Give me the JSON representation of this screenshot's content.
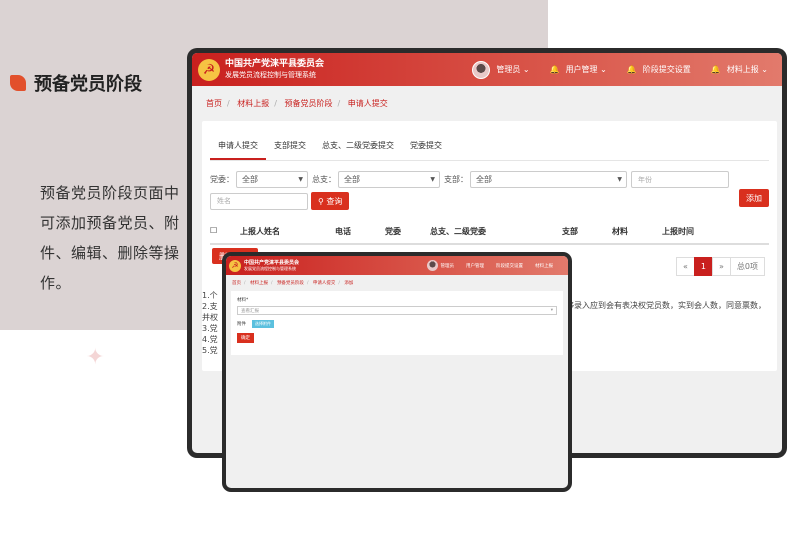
{
  "slide": {
    "title": "预备党员阶段",
    "description": "预备党员阶段页面中可添加预备党员、附件、编辑、删除等操作。"
  },
  "header": {
    "org_line1": "中国共产党涞平县委员会",
    "org_line2": "发展党员流程控制与管理系统",
    "user": "管理员",
    "menu_user_mgmt": "用户管理",
    "menu_stage_setting": "阶段提交设置",
    "menu_material_report": "材料上报"
  },
  "breadcrumb": [
    "首页",
    "材料上报",
    "预备党员阶段",
    "申请人提交"
  ],
  "tabs": [
    "申请人提交",
    "支部提交",
    "总支、二级党委提交",
    "党委提交"
  ],
  "filters": {
    "party_committee_label": "党委：",
    "party_committee_value": "全部",
    "general_branch_label": "总支：",
    "general_branch_value": "全部",
    "branch_label": "支部：",
    "branch_value": "全部",
    "year_placeholder": "年份",
    "name_placeholder": "姓名",
    "search_button": "查询",
    "add_button": "添加"
  },
  "table": {
    "columns": [
      "上报人姓名",
      "电话",
      "党委",
      "总支、二级党委",
      "支部",
      "材料",
      "上报时间"
    ]
  },
  "actions": {
    "delete_selected": "删除选中"
  },
  "pagination": {
    "prev": "«",
    "current": "1",
    "next": "»",
    "total": "总0项"
  },
  "notes": [
    "1.个",
    "2.支",
    "并权",
    "3.党",
    "4.党",
    "5.党"
  ],
  "note_right": "能够录入应到会有表决权党员数，实到会人数，同意票数，",
  "small_screen": {
    "breadcrumb": [
      "首页",
      "材料上报",
      "预备党员阶段",
      "申请人提交",
      "添加"
    ],
    "material_label": "材料*",
    "material_select": "查看汇报",
    "attachment_label": "附件",
    "upload_button": "选择附件",
    "confirm_button": "确定"
  },
  "colors": {
    "brand_red": "#c9201e",
    "panel_bg": "#dbd3d3"
  }
}
